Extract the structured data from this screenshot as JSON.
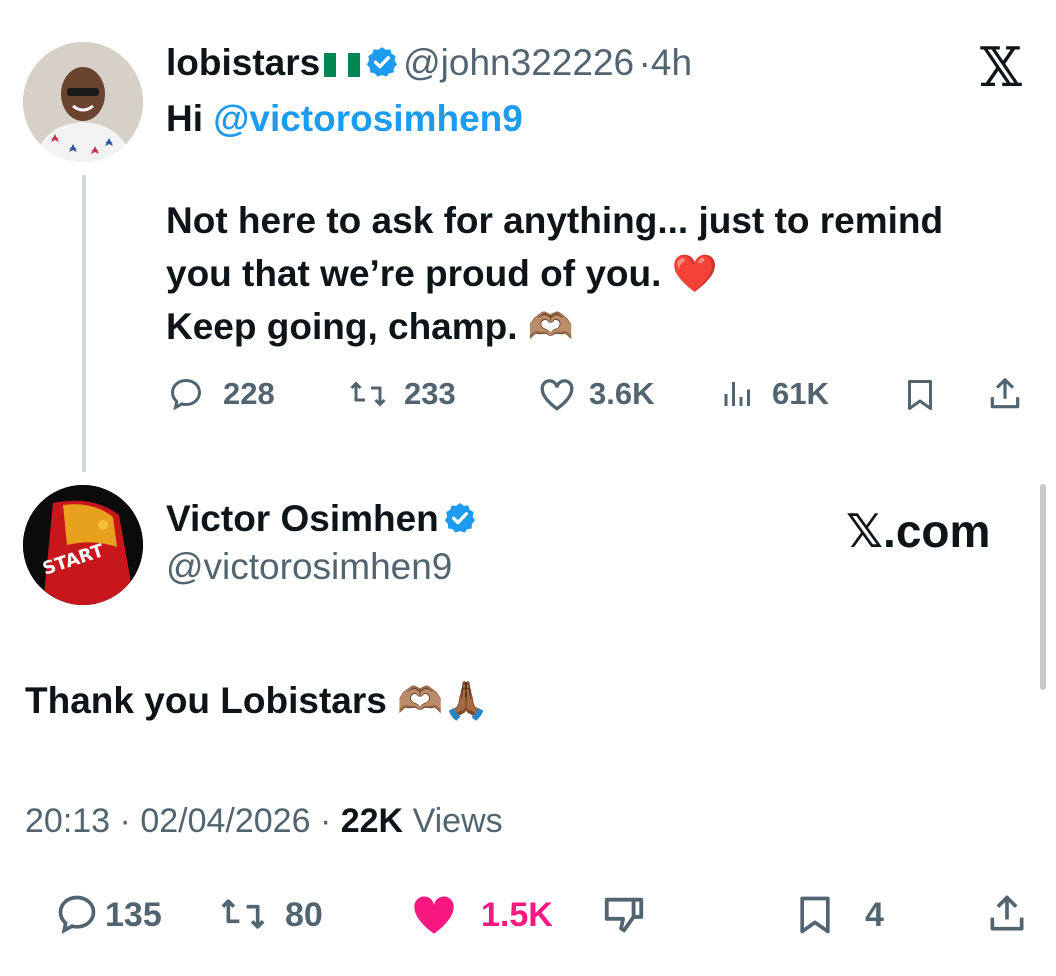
{
  "colors": {
    "accent": "#1d9bf0",
    "muted": "#536471",
    "like": "#f91880",
    "text": "#0f1419"
  },
  "tweet1": {
    "name": "lobistars",
    "flag_icon": "nigeria-flag-icon",
    "handle": "@john322226",
    "separator": "·",
    "time": "4h",
    "greeting": "Hi",
    "mention": "@victorosimhen9",
    "line1": "Not here to ask for anything... just to remind",
    "line2": "you that we’re proud of you.",
    "line3": "Keep going, champ.",
    "emoji_heart": "❤️",
    "emoji_hands": "🫶🏽",
    "stats": {
      "replies": "228",
      "reposts": "233",
      "likes": "3.6K",
      "views": "61K"
    }
  },
  "x_logo": "𝕏",
  "tweet2": {
    "name": "Victor Osimhen",
    "handle": "@victorosimhen9",
    "site": "𝕏.com",
    "text": "Thank you Lobistars",
    "emoji_hands": "🫶🏽",
    "emoji_pray": "🙏🏾",
    "jersey_text": "START",
    "time": "20:13",
    "sep": "·",
    "date": "02/04/2026",
    "views_count": "22K",
    "views_label": "Views",
    "stats": {
      "replies": "135",
      "reposts": "80",
      "likes": "1.5K",
      "bookmarks": "4"
    }
  }
}
